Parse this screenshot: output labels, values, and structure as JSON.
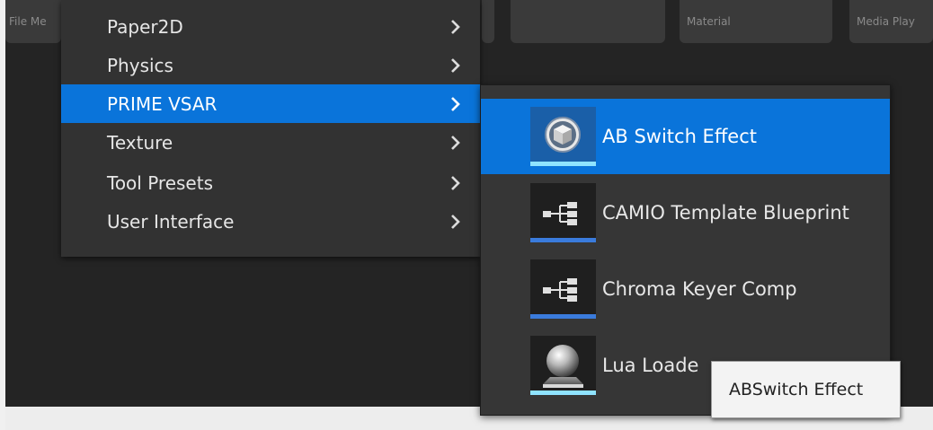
{
  "asset_tiles": {
    "file_media": "File Me",
    "material": "Material",
    "media_player": "Media Play"
  },
  "menu": {
    "items": [
      {
        "label": "Paper2D"
      },
      {
        "label": "Physics"
      },
      {
        "label": "PRIME VSAR"
      },
      {
        "label": "Texture"
      },
      {
        "label": "Tool Presets"
      },
      {
        "label": "User Interface"
      }
    ]
  },
  "submenu": {
    "items": [
      {
        "label": "AB Switch Effect",
        "icon": "cube-icon",
        "bar_color": "#8fe3ff"
      },
      {
        "label": "CAMIO Template Blueprint",
        "icon": "blueprint-icon",
        "bar_color": "#3a7bdc"
      },
      {
        "label": "Chroma Keyer Comp",
        "icon": "blueprint-icon",
        "bar_color": "#3a7bdc"
      },
      {
        "label": "Lua Loade",
        "icon": "sphere-icon",
        "bar_color": "#8fe3ff"
      }
    ]
  },
  "tooltip": {
    "text": "ABSwitch Effect"
  },
  "colors": {
    "highlight": "#0a74da",
    "menu_bg": "#323232",
    "tooltip_bg": "#f3f3f3"
  }
}
